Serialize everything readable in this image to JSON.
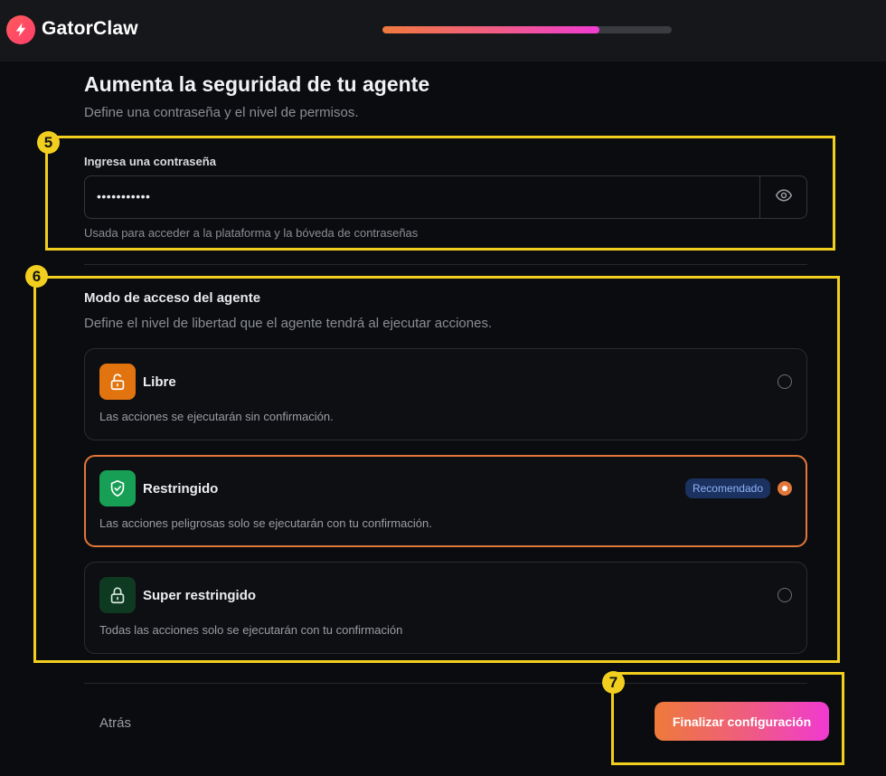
{
  "app": {
    "name": "GatorClaw",
    "progress_fraction": 0.75
  },
  "page": {
    "title": "Aumenta la seguridad de tu agente",
    "subtitle": "Define una contraseña y el nivel de permisos."
  },
  "password": {
    "label": "Ingresa una contraseña",
    "value": "•••••••••••",
    "help": "Usada para acceder a la plataforma y la bóveda de contraseñas"
  },
  "access_mode": {
    "title": "Modo de acceso del agente",
    "subtitle": "Define el nivel de libertad que el agente tendrá al ejecutar acciones.",
    "options": [
      {
        "title": "Libre",
        "description": "Las acciones se ejecutarán sin confirmación.",
        "icon": "unlock-icon",
        "icon_bg": "#e2740f",
        "selected": false
      },
      {
        "title": "Restringido",
        "description": "Las acciones peligrosas solo se ejecutarán con tu confirmación.",
        "icon": "shield-check-icon",
        "icon_bg": "#17a055",
        "badge": "Recomendado",
        "selected": true
      },
      {
        "title": "Super restringido",
        "description": "Todas las acciones solo se ejecutarán con tu confirmación",
        "icon": "lock-icon",
        "icon_bg": "#0f3a22",
        "selected": false
      }
    ]
  },
  "footer": {
    "back_label": "Atrás",
    "finish_label": "Finalizar configuración"
  },
  "annotations": [
    {
      "number": "5"
    },
    {
      "number": "6"
    },
    {
      "number": "7"
    }
  ],
  "colors": {
    "accent_orange": "#e2773a",
    "annotation_yellow": "#f2cf1f",
    "badge_bg": "#1b3160",
    "badge_text": "#8fb3f5"
  }
}
